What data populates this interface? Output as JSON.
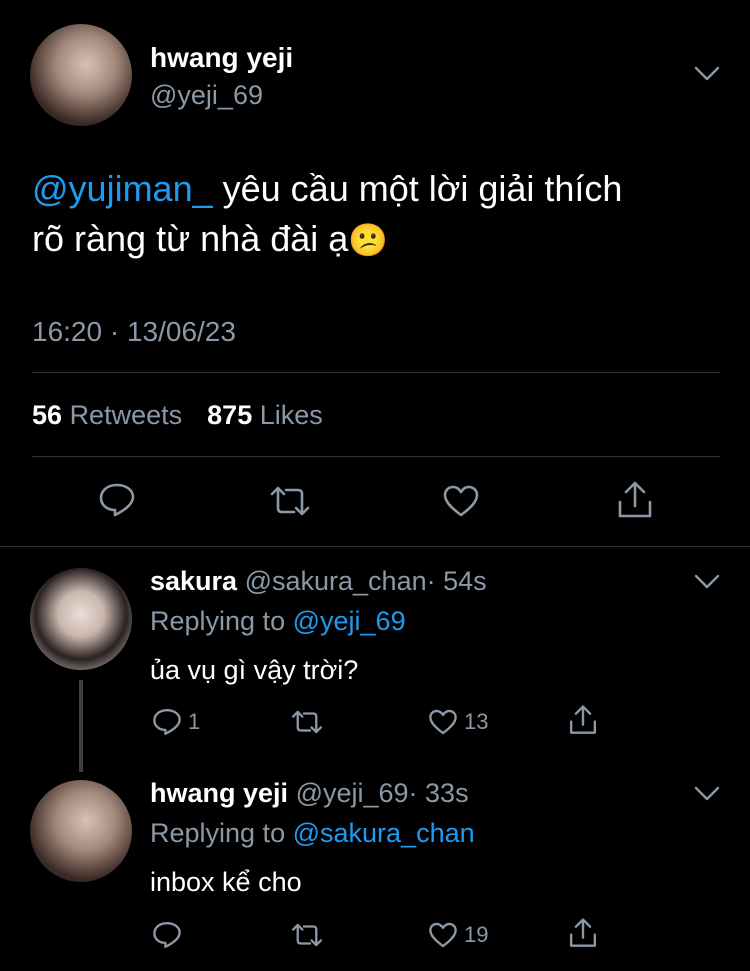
{
  "main_tweet": {
    "name": "hwang yeji",
    "handle": "@yeji_69",
    "mention": "@yujiman_",
    "text_line1": " yêu cầu một lời giải thích",
    "text_line2": "rõ ràng từ nhà đài ạ",
    "emoji": "😕",
    "timestamp": "16:20 · 13/06/23",
    "retweets_count": "56",
    "retweets_label": "Retweets",
    "likes_count": "875",
    "likes_label": "Likes"
  },
  "replies": [
    {
      "name": "sakura",
      "handle": "@sakura_chan",
      "time": "· 54s",
      "replying_label": "Replying to",
      "replying_to": "@yeji_69",
      "text": "ủa vụ gì vậy trời?",
      "reply_count": "1",
      "retweet_count": "",
      "like_count": "13"
    },
    {
      "name": "hwang yeji",
      "handle": "@yeji_69",
      "time": "· 33s",
      "replying_label": "Replying to",
      "replying_to": "@sakura_chan",
      "text": "inbox kể cho",
      "reply_count": "",
      "retweet_count": "",
      "like_count": "19"
    }
  ],
  "colors": {
    "background": "#000000",
    "text": "#ffffff",
    "muted": "#8b98a5",
    "link": "#1d9bf0",
    "divider": "#2f3336"
  }
}
